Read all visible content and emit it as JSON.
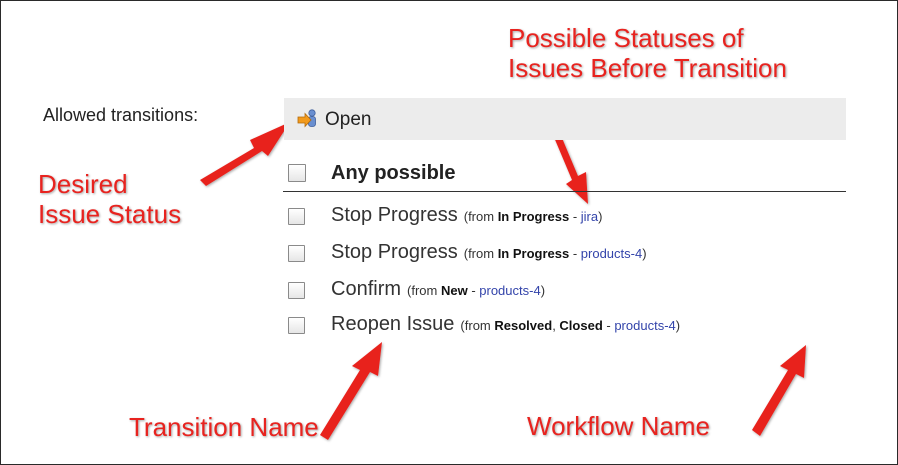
{
  "form": {
    "allowed_label": "Allowed transitions:",
    "target_status": "Open",
    "any_possible_label": "Any possible",
    "transitions": [
      {
        "name": "Stop Progress",
        "from_prefix": "(from ",
        "from_statuses": "In Progress",
        "sep": " - ",
        "workflow": "jira",
        "suffix": ")"
      },
      {
        "name": "Stop Progress",
        "from_prefix": "(from ",
        "from_statuses": "In Progress",
        "sep": " - ",
        "workflow": "products-4",
        "suffix": ")"
      },
      {
        "name": "Confirm",
        "from_prefix": "(from ",
        "from_statuses": "New",
        "sep": " - ",
        "workflow": "products-4",
        "suffix": ")"
      },
      {
        "name": "Reopen Issue",
        "from_prefix": "(from ",
        "from_statuses_1": "Resolved",
        "comma": ", ",
        "from_statuses_2": "Closed",
        "sep": " - ",
        "workflow": "products-4",
        "suffix": ")"
      }
    ]
  },
  "annotations": {
    "top_line1": "Possible Statuses of",
    "top_line2": "Issues Before Transition",
    "status_line1": "Desired",
    "status_line2": "Issue Status",
    "transition_name": "Transition Name",
    "workflow_name": "Workflow Name"
  },
  "icons": {
    "status": "status-arrow-person-icon",
    "checkbox": "checkbox-icon"
  },
  "colors": {
    "annotation": "#e8231f",
    "workflow_link": "#3344aa",
    "status_bar": "#ececec"
  }
}
